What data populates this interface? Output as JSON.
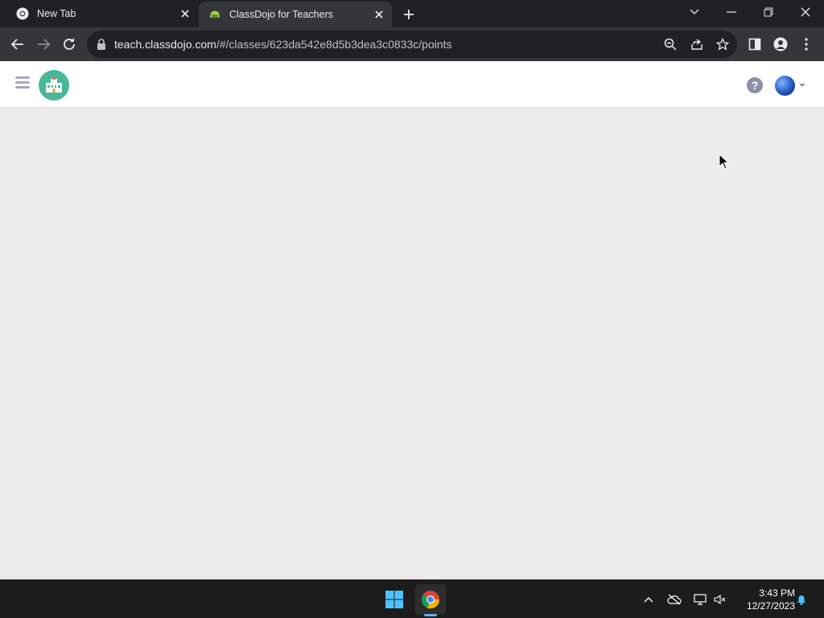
{
  "browser": {
    "tabs": [
      {
        "title": "New Tab",
        "favicon": "chrome-icon",
        "active": false
      },
      {
        "title": "ClassDojo for Teachers",
        "favicon": "classdojo-icon",
        "active": true
      }
    ],
    "url_host": "teach.classdojo.com",
    "url_path": "/#/classes/623da542e8d5b3dea3c0833c/points"
  },
  "page": {
    "header": {
      "menu_icon": "hamburger-icon",
      "logo_icon": "school-icon",
      "help_label": "?",
      "avatar_icon": "globe-avatar"
    }
  },
  "taskbar": {
    "time": "3:43 PM",
    "date": "12/27/2023"
  },
  "colors": {
    "tab_bar": "#202124",
    "toolbar": "#35363a",
    "page_bg": "#ececec",
    "logo_bg": "#49b89a",
    "taskbar": "#1c1c1c",
    "accent": "#5fb2f2"
  }
}
